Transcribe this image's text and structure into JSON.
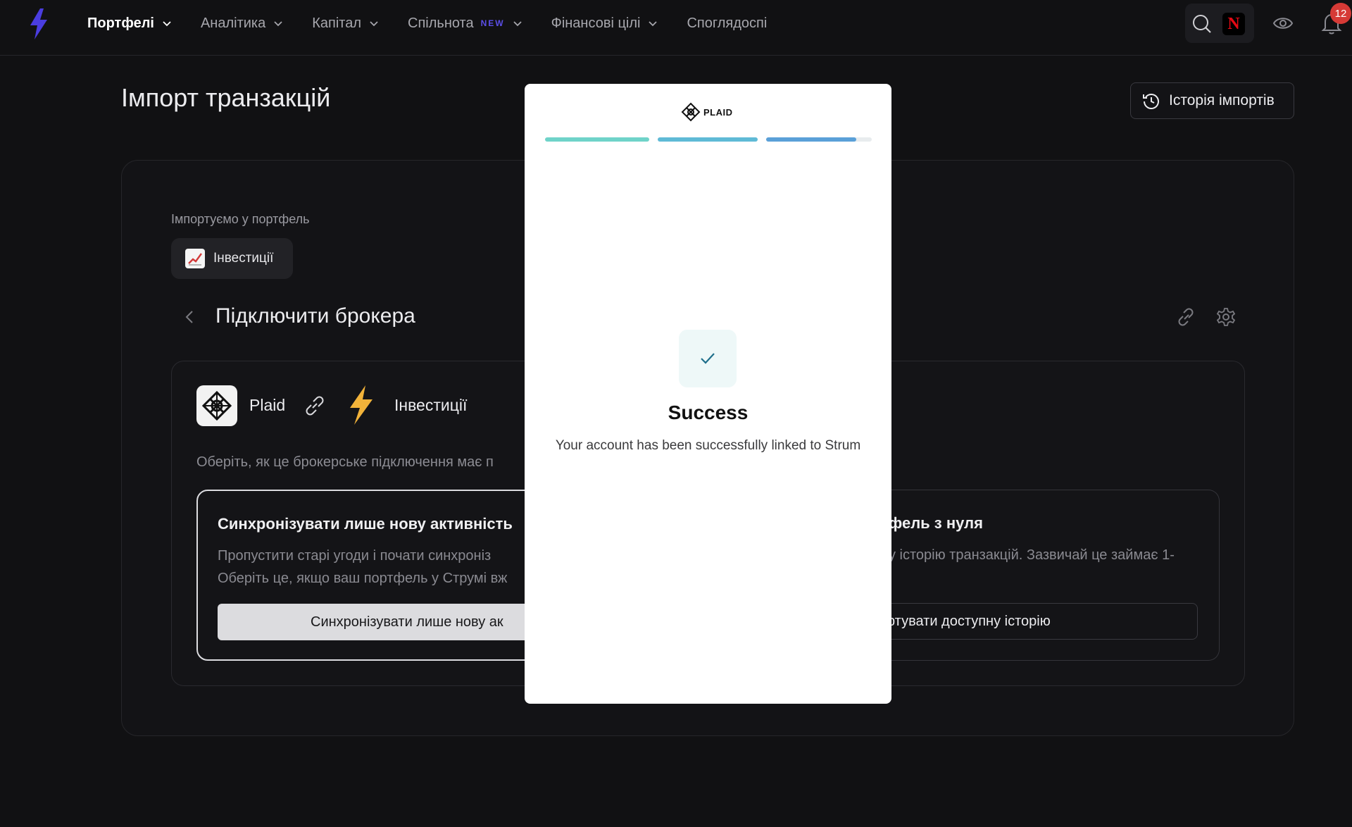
{
  "nav": {
    "items": [
      {
        "label": "Портфелі",
        "active": true,
        "has_chevron": true
      },
      {
        "label": "Аналітика",
        "active": false,
        "has_chevron": true
      },
      {
        "label": "Капітал",
        "active": false,
        "has_chevron": true
      },
      {
        "label": "Спільнота",
        "active": false,
        "has_chevron": true,
        "badge": "NEW"
      },
      {
        "label": "Фінансові цілі",
        "active": false,
        "has_chevron": true
      },
      {
        "label": "Споглядоспі",
        "active": false,
        "has_chevron": false
      }
    ],
    "notifications_count": "12",
    "netflix_glyph": "N"
  },
  "page": {
    "title": "Імпорт транзакцій",
    "history_button": "Історія імпортів",
    "import_label": "Імпортуємо у портфель",
    "portfolio_name": "Інвестиції",
    "section_title": "Підключити брокера"
  },
  "broker": {
    "provider_name": "Plaid",
    "target_name": "Інвестиції",
    "choose_text": "Оберіть, як це брокерське підключення має п",
    "option_left": {
      "title": "Синхронізувати лише нову активність",
      "desc_line1": "Пропустити старі угоди і почати синхроніз",
      "desc_line2": "Оберіть це, якщо ваш портфель у Струмі вж",
      "button": "Синхронізувати лише нову ак"
    },
    "option_right": {
      "title": "фель з нуля",
      "desc_line1": "у історію транзакцій. Зазвичай це займає 1-",
      "button": "ртувати доступну історію"
    }
  },
  "modal": {
    "brand": "PLAID",
    "progress_segments": 3,
    "progress_last_fill": 0.85,
    "title": "Success",
    "message": "Your account has been successfully linked to Strum"
  },
  "colors": {
    "background": "#111113",
    "accent_purple": "#4a3de0",
    "badge_red": "#d63a36",
    "progress_teal": "#6fd3c9",
    "progress_blue": "#5aa0d8"
  }
}
